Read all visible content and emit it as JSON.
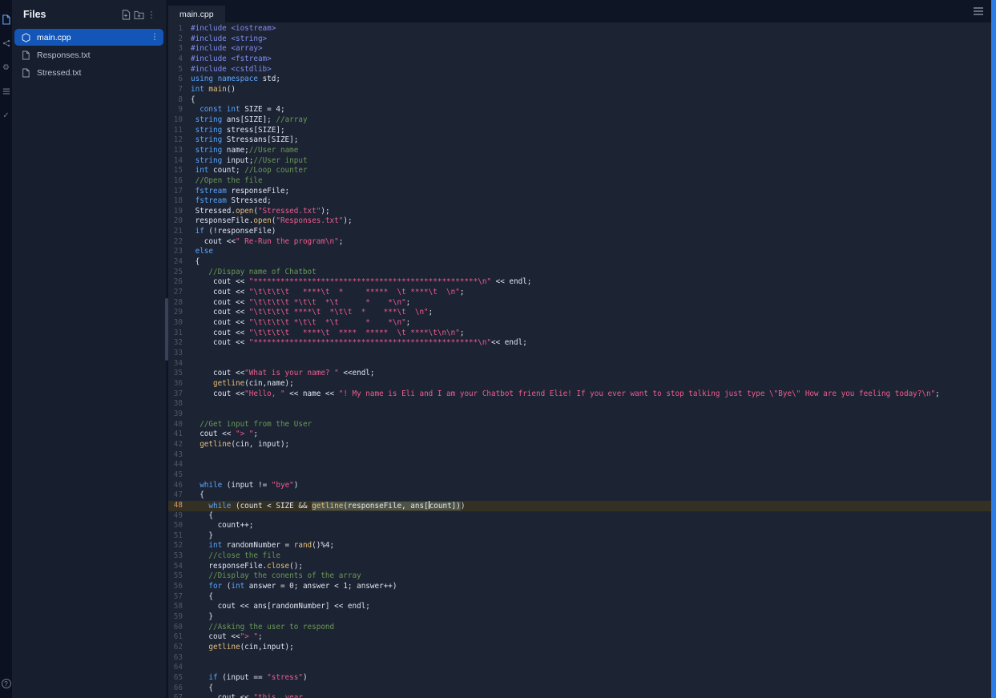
{
  "colors": {
    "background": "#0e1525",
    "panel": "#171e2e",
    "editor_bg": "#1c2333",
    "selected_file": "#1456b8",
    "active_line_bg": "#343023",
    "selection_bg": "#4e5346",
    "accent_right_bar": "#2b7de9",
    "syntax": {
      "preprocessor": "#7f8cf0",
      "keyword": "#59a6ff",
      "function": "#e5c07b",
      "string": "#ee5d90",
      "comment": "#6a9955",
      "text": "#e0e5f0",
      "line_number": "#4d5668",
      "active_line_number": "#d19a66"
    }
  },
  "rail": {
    "icons": [
      "files-icon",
      "version-control-icon",
      "settings-icon",
      "console-icon",
      "checklist-icon"
    ],
    "help_label": "?"
  },
  "files_panel": {
    "title": "Files",
    "header_icons": [
      "add-file-icon",
      "add-folder-icon",
      "more-options-icon"
    ],
    "items": [
      {
        "name": "main.cpp",
        "selected": true
      },
      {
        "name": "Responses.txt",
        "selected": false
      },
      {
        "name": "Stressed.txt",
        "selected": false
      }
    ]
  },
  "editor": {
    "tabs": [
      {
        "label": "main.cpp",
        "active": true
      }
    ],
    "active_line": 48,
    "lines": [
      {
        "n": 1,
        "seg": [
          [
            "p",
            "#include <iostream>"
          ]
        ]
      },
      {
        "n": 2,
        "seg": [
          [
            "p",
            "#include <string>"
          ]
        ]
      },
      {
        "n": 3,
        "seg": [
          [
            "p",
            "#include <array>"
          ]
        ]
      },
      {
        "n": 4,
        "seg": [
          [
            "p",
            "#include <fstream>"
          ]
        ]
      },
      {
        "n": 5,
        "seg": [
          [
            "p",
            "#include <cstdlib>"
          ]
        ]
      },
      {
        "n": 6,
        "seg": [
          [
            "k",
            "using namespace "
          ],
          [
            "t",
            "std;"
          ]
        ]
      },
      {
        "n": 7,
        "seg": [
          [
            "k",
            "int "
          ],
          [
            "f",
            "main"
          ],
          [
            "t",
            "()"
          ]
        ]
      },
      {
        "n": 8,
        "seg": [
          [
            "t",
            "{"
          ]
        ]
      },
      {
        "n": 9,
        "seg": [
          [
            "t",
            "  "
          ],
          [
            "k",
            "const "
          ],
          [
            "k",
            "int "
          ],
          [
            "t",
            "SIZE = 4;"
          ]
        ]
      },
      {
        "n": 10,
        "seg": [
          [
            "t",
            " "
          ],
          [
            "k",
            "string "
          ],
          [
            "t",
            "ans[SIZE]; "
          ],
          [
            "c",
            "//array"
          ]
        ]
      },
      {
        "n": 11,
        "seg": [
          [
            "t",
            " "
          ],
          [
            "k",
            "string "
          ],
          [
            "t",
            "stress[SIZE];"
          ]
        ]
      },
      {
        "n": 12,
        "seg": [
          [
            "t",
            " "
          ],
          [
            "k",
            "string "
          ],
          [
            "t",
            "Stressans[SIZE];"
          ]
        ]
      },
      {
        "n": 13,
        "seg": [
          [
            "t",
            " "
          ],
          [
            "k",
            "string "
          ],
          [
            "t",
            "name;"
          ],
          [
            "c",
            "//User name"
          ]
        ]
      },
      {
        "n": 14,
        "seg": [
          [
            "t",
            " "
          ],
          [
            "k",
            "string "
          ],
          [
            "t",
            "input;"
          ],
          [
            "c",
            "//User input"
          ]
        ]
      },
      {
        "n": 15,
        "seg": [
          [
            "t",
            " "
          ],
          [
            "k",
            "int "
          ],
          [
            "t",
            "count; "
          ],
          [
            "c",
            "//Loop counter"
          ]
        ]
      },
      {
        "n": 16,
        "seg": [
          [
            "t",
            " "
          ],
          [
            "c",
            "//Open the file"
          ]
        ]
      },
      {
        "n": 17,
        "seg": [
          [
            "t",
            " "
          ],
          [
            "k",
            "fstream "
          ],
          [
            "t",
            "responseFile;"
          ]
        ]
      },
      {
        "n": 18,
        "seg": [
          [
            "t",
            " "
          ],
          [
            "k",
            "fstream "
          ],
          [
            "t",
            "Stressed;"
          ]
        ]
      },
      {
        "n": 19,
        "seg": [
          [
            "t",
            " Stressed."
          ],
          [
            "f",
            "open"
          ],
          [
            "t",
            "("
          ],
          [
            "s",
            "\"Stressed.txt\""
          ],
          [
            "t",
            ");"
          ]
        ]
      },
      {
        "n": 20,
        "seg": [
          [
            "t",
            " responseFile."
          ],
          [
            "f",
            "open"
          ],
          [
            "t",
            "("
          ],
          [
            "s",
            "\"Responses.txt\""
          ],
          [
            "t",
            ");"
          ]
        ]
      },
      {
        "n": 21,
        "seg": [
          [
            "t",
            " "
          ],
          [
            "k",
            "if "
          ],
          [
            "t",
            "(!responseFile)"
          ]
        ]
      },
      {
        "n": 22,
        "seg": [
          [
            "t",
            "   cout <<"
          ],
          [
            "s",
            "\" Re-Run the program\\n\""
          ],
          [
            "t",
            ";"
          ]
        ]
      },
      {
        "n": 23,
        "seg": [
          [
            "t",
            " "
          ],
          [
            "k",
            "else"
          ]
        ]
      },
      {
        "n": 24,
        "seg": [
          [
            "t",
            " {"
          ]
        ]
      },
      {
        "n": 25,
        "seg": [
          [
            "t",
            "    "
          ],
          [
            "c",
            "//Dispay name of Chatbot"
          ]
        ]
      },
      {
        "n": 26,
        "seg": [
          [
            "t",
            "     cout << "
          ],
          [
            "s",
            "\"**************************************************\\n\""
          ],
          [
            "t",
            " << endl;"
          ]
        ]
      },
      {
        "n": 27,
        "seg": [
          [
            "t",
            "     cout << "
          ],
          [
            "s",
            "\"\\t\\t\\t\\t   ****\\t  *     *****  \\t ****\\t  \\n\""
          ],
          [
            "t",
            ";"
          ]
        ]
      },
      {
        "n": 28,
        "seg": [
          [
            "t",
            "     cout << "
          ],
          [
            "s",
            "\"\\t\\t\\t\\t *\\t\\t  *\\t      *    *\\n\""
          ],
          [
            "t",
            ";"
          ]
        ]
      },
      {
        "n": 29,
        "seg": [
          [
            "t",
            "     cout << "
          ],
          [
            "s",
            "\"\\t\\t\\t\\t ****\\t  *\\t\\t  *    ***\\t  \\n\""
          ],
          [
            "t",
            ";"
          ]
        ]
      },
      {
        "n": 30,
        "seg": [
          [
            "t",
            "     cout << "
          ],
          [
            "s",
            "\"\\t\\t\\t\\t *\\t\\t  *\\t      *    *\\n\""
          ],
          [
            "t",
            ";"
          ]
        ]
      },
      {
        "n": 31,
        "seg": [
          [
            "t",
            "     cout << "
          ],
          [
            "s",
            "\"\\t\\t\\t\\t   ****\\t  ****  *****  \\t ****\\t\\n\\n\""
          ],
          [
            "t",
            ";"
          ]
        ]
      },
      {
        "n": 32,
        "seg": [
          [
            "t",
            "     cout << "
          ],
          [
            "s",
            "\"**************************************************\\n\""
          ],
          [
            "t",
            "<< endl;"
          ]
        ]
      },
      {
        "n": 33,
        "seg": []
      },
      {
        "n": 34,
        "seg": []
      },
      {
        "n": 35,
        "seg": [
          [
            "t",
            "     cout <<"
          ],
          [
            "s",
            "\"What is your name? \""
          ],
          [
            "t",
            " <<endl;"
          ]
        ]
      },
      {
        "n": 36,
        "seg": [
          [
            "t",
            "     "
          ],
          [
            "f",
            "getline"
          ],
          [
            "t",
            "(cin,name);"
          ]
        ]
      },
      {
        "n": 37,
        "seg": [
          [
            "t",
            "     cout <<"
          ],
          [
            "s",
            "\"Hello, \""
          ],
          [
            "t",
            " << name << "
          ],
          [
            "s",
            "\"! My name is Eli and I am your Chatbot friend Elie! If you ever want to stop talking just type \\\"Bye\\\" How are you feeling today?\\n\""
          ],
          [
            "t",
            ";"
          ]
        ]
      },
      {
        "n": 38,
        "seg": []
      },
      {
        "n": 39,
        "seg": []
      },
      {
        "n": 40,
        "seg": [
          [
            "t",
            "  "
          ],
          [
            "c",
            "//Get input from the User"
          ]
        ]
      },
      {
        "n": 41,
        "seg": [
          [
            "t",
            "  cout << "
          ],
          [
            "s",
            "\"> \""
          ],
          [
            "t",
            ";"
          ]
        ]
      },
      {
        "n": 42,
        "seg": [
          [
            "t",
            "  "
          ],
          [
            "f",
            "getline"
          ],
          [
            "t",
            "(cin, input);"
          ]
        ]
      },
      {
        "n": 43,
        "seg": []
      },
      {
        "n": 44,
        "seg": []
      },
      {
        "n": 45,
        "seg": []
      },
      {
        "n": 46,
        "seg": [
          [
            "t",
            "  "
          ],
          [
            "k",
            "while "
          ],
          [
            "t",
            "(input != "
          ],
          [
            "s",
            "\"bye\""
          ],
          [
            "t",
            ")"
          ]
        ]
      },
      {
        "n": 47,
        "seg": [
          [
            "t",
            "  {"
          ]
        ]
      },
      {
        "n": 48,
        "seg": [
          [
            "t",
            "    "
          ],
          [
            "k",
            "while "
          ],
          [
            "t",
            "(count < SIZE && "
          ],
          [
            "sf",
            "getline"
          ],
          [
            "st",
            "(responseFile, ans["
          ],
          [
            "caret",
            ""
          ],
          [
            "st",
            "count])"
          ],
          [
            "t",
            ")"
          ]
        ]
      },
      {
        "n": 49,
        "seg": [
          [
            "t",
            "    {"
          ]
        ]
      },
      {
        "n": 50,
        "seg": [
          [
            "t",
            "      count++;"
          ]
        ]
      },
      {
        "n": 51,
        "seg": [
          [
            "t",
            "    }"
          ]
        ]
      },
      {
        "n": 52,
        "seg": [
          [
            "t",
            "    "
          ],
          [
            "k",
            "int "
          ],
          [
            "t",
            "randomNumber = "
          ],
          [
            "f",
            "rand"
          ],
          [
            "t",
            "()%4;"
          ]
        ]
      },
      {
        "n": 53,
        "seg": [
          [
            "t",
            "    "
          ],
          [
            "c",
            "//close the file"
          ]
        ]
      },
      {
        "n": 54,
        "seg": [
          [
            "t",
            "    responseFile."
          ],
          [
            "f",
            "close"
          ],
          [
            "t",
            "();"
          ]
        ]
      },
      {
        "n": 55,
        "seg": [
          [
            "t",
            "    "
          ],
          [
            "c",
            "//Display the conents of the array"
          ]
        ]
      },
      {
        "n": 56,
        "seg": [
          [
            "t",
            "    "
          ],
          [
            "k",
            "for "
          ],
          [
            "t",
            "("
          ],
          [
            "k",
            "int "
          ],
          [
            "t",
            "answer = 0; answer < 1; answer++)"
          ]
        ]
      },
      {
        "n": 57,
        "seg": [
          [
            "t",
            "    {"
          ]
        ]
      },
      {
        "n": 58,
        "seg": [
          [
            "t",
            "      cout << ans[randomNumber] << endl;"
          ]
        ]
      },
      {
        "n": 59,
        "seg": [
          [
            "t",
            "    }"
          ]
        ]
      },
      {
        "n": 60,
        "seg": [
          [
            "t",
            "    "
          ],
          [
            "c",
            "//Asking the user to respond"
          ]
        ]
      },
      {
        "n": 61,
        "seg": [
          [
            "t",
            "    cout <<"
          ],
          [
            "s",
            "\"> \""
          ],
          [
            "t",
            ";"
          ]
        ]
      },
      {
        "n": 62,
        "seg": [
          [
            "t",
            "    "
          ],
          [
            "f",
            "getline"
          ],
          [
            "t",
            "(cin,input);"
          ]
        ]
      },
      {
        "n": 63,
        "seg": []
      },
      {
        "n": 64,
        "seg": []
      },
      {
        "n": 65,
        "seg": [
          [
            "t",
            "    "
          ],
          [
            "k",
            "if "
          ],
          [
            "t",
            "(input == "
          ],
          [
            "s",
            "\"stress\""
          ],
          [
            "t",
            ")"
          ]
        ]
      },
      {
        "n": 66,
        "seg": [
          [
            "t",
            "    {"
          ]
        ]
      },
      {
        "n": 67,
        "seg": [
          [
            "t",
            "      cout << "
          ],
          [
            "s",
            "\"this  year"
          ]
        ]
      }
    ]
  }
}
